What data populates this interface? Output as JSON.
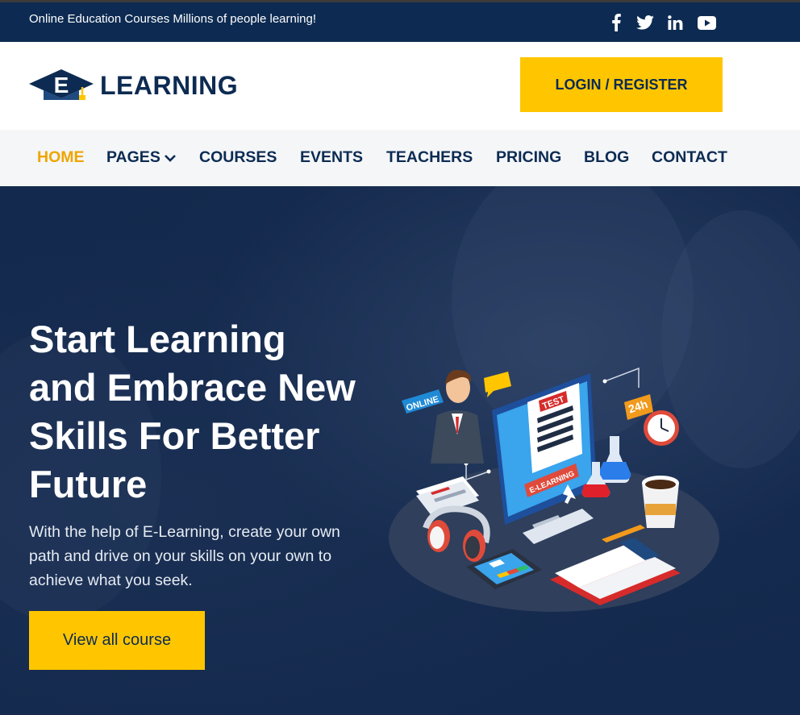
{
  "topbar": {
    "tagline": "Online Education Courses Millions of people learning!",
    "social": [
      "facebook-icon",
      "twitter-icon",
      "linkedin-icon",
      "youtube-icon"
    ]
  },
  "header": {
    "logo_letter": "E",
    "logo_word": "LEARNING",
    "login_label": "LOGIN / REGISTER"
  },
  "nav": {
    "items": [
      {
        "label": "HOME",
        "active": true
      },
      {
        "label": "PAGES",
        "has_dropdown": true
      },
      {
        "label": "COURSES"
      },
      {
        "label": "EVENTS"
      },
      {
        "label": "TEACHERS"
      },
      {
        "label": "PRICING"
      },
      {
        "label": "BLOG"
      },
      {
        "label": "CONTACT"
      }
    ]
  },
  "hero": {
    "title_lines": [
      "Start Learning",
      "and Embrace New",
      "Skills For Better",
      "Future"
    ],
    "description": "With the help of E-Learning, create your own path and drive on your skills on your own to achieve what you seek.",
    "cta_label": "View all course",
    "illustration": {
      "online_tag": "ONLINE",
      "test_label": "TEST",
      "screen_banner": "E-LEARNING",
      "badge_24h": "24h"
    }
  },
  "colors": {
    "navy": "#0d2b52",
    "accent": "#ffc600",
    "active_nav": "#f0a500",
    "hero_bg": "#13294d"
  }
}
